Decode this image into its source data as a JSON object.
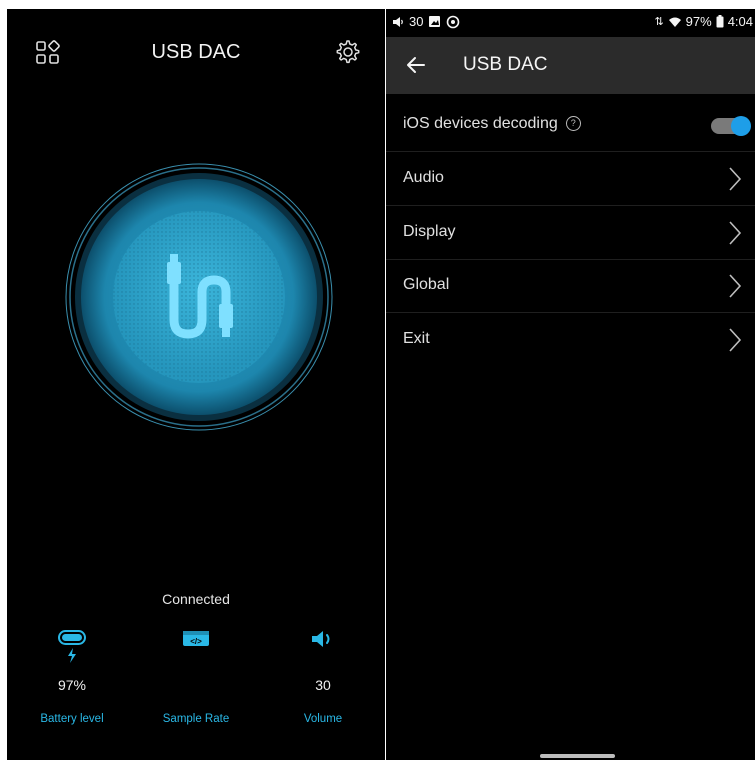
{
  "left": {
    "title": "USB DAC",
    "status": "Connected",
    "stats": [
      {
        "value": "97%",
        "label": "Battery level",
        "icon": "battery-charging-icon"
      },
      {
        "value": "",
        "label": "Sample Rate",
        "icon": "sample-rate-icon"
      },
      {
        "value": "30",
        "label": "Volume",
        "icon": "volume-icon"
      }
    ],
    "icons": {
      "top_left": "apps-grid-icon",
      "top_right": "gear-icon",
      "center": "usb-cable-icon"
    }
  },
  "right": {
    "status_bar": {
      "volume": "30",
      "battery": "97%",
      "time": "4:04"
    },
    "title": "USB DAC",
    "rows": [
      {
        "label": "iOS devices decoding",
        "help": "?",
        "toggle_on": true
      },
      {
        "label": "Audio"
      },
      {
        "label": "Display"
      },
      {
        "label": "Global"
      },
      {
        "label": "Exit"
      }
    ]
  },
  "colors": {
    "accent": "#2ab8e6",
    "background": "#000000",
    "appbar": "#2b2b2b",
    "toggle": "#1e9ee8"
  }
}
